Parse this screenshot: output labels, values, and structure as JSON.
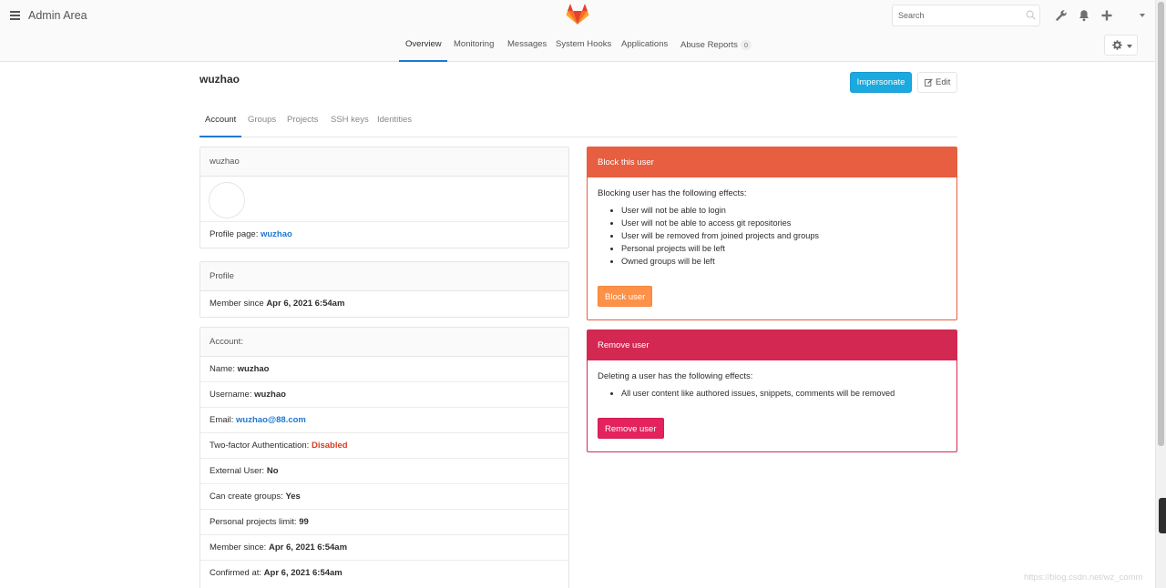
{
  "header": {
    "area_title": "Admin Area",
    "search_placeholder": "Search"
  },
  "nav": {
    "items": [
      {
        "label": "Overview",
        "active": true
      },
      {
        "label": "Monitoring"
      },
      {
        "label": "Messages"
      },
      {
        "label": "System Hooks"
      },
      {
        "label": "Applications"
      },
      {
        "label": "Abuse Reports",
        "badge": "0"
      }
    ]
  },
  "user": {
    "title": "wuzhao",
    "impersonate_label": "Impersonate",
    "edit_label": "Edit"
  },
  "tabs": [
    {
      "label": "Account",
      "active": true
    },
    {
      "label": "Groups"
    },
    {
      "label": "Projects"
    },
    {
      "label": "SSH keys"
    },
    {
      "label": "Identities"
    }
  ],
  "profile_panel": {
    "heading": "wuzhao",
    "profile_page_label": "Profile page:",
    "profile_page_link": "wuzhao"
  },
  "profile_info": {
    "heading": "Profile",
    "member_since_label": "Member since",
    "member_since_value": "Apr 6, 2021 6:54am"
  },
  "account": {
    "heading": "Account:",
    "rows": {
      "name": {
        "label": "Name:",
        "value": "wuzhao"
      },
      "username": {
        "label": "Username:",
        "value": "wuzhao"
      },
      "email": {
        "label": "Email:",
        "value": "wuzhao@88.com"
      },
      "two_factor": {
        "label": "Two-factor Authentication:",
        "value": "Disabled"
      },
      "external": {
        "label": "External User:",
        "value": "No"
      },
      "create_groups": {
        "label": "Can create groups:",
        "value": "Yes"
      },
      "projects_limit": {
        "label": "Personal projects limit:",
        "value": "99"
      },
      "member_since": {
        "label": "Member since:",
        "value": "Apr 6, 2021 6:54am"
      },
      "confirmed_at": {
        "label": "Confirmed at:",
        "value": "Apr 6, 2021 6:54am"
      }
    }
  },
  "block": {
    "heading": "Block this user",
    "intro": "Blocking user has the following effects:",
    "effects": [
      "User will not be able to login",
      "User will not be able to access git repositories",
      "User will be removed from joined projects and groups",
      "Personal projects will be left",
      "Owned groups will be left"
    ],
    "button_label": "Block user",
    "color": "#e75e40"
  },
  "remove": {
    "heading": "Remove user",
    "intro": "Deleting a user has the following effects:",
    "effects": [
      "All user content like authored issues, snippets, comments will be removed"
    ],
    "button_label": "Remove user",
    "color": "#d22852"
  },
  "watermark": "https://blog.csdn.net/wz_comm"
}
